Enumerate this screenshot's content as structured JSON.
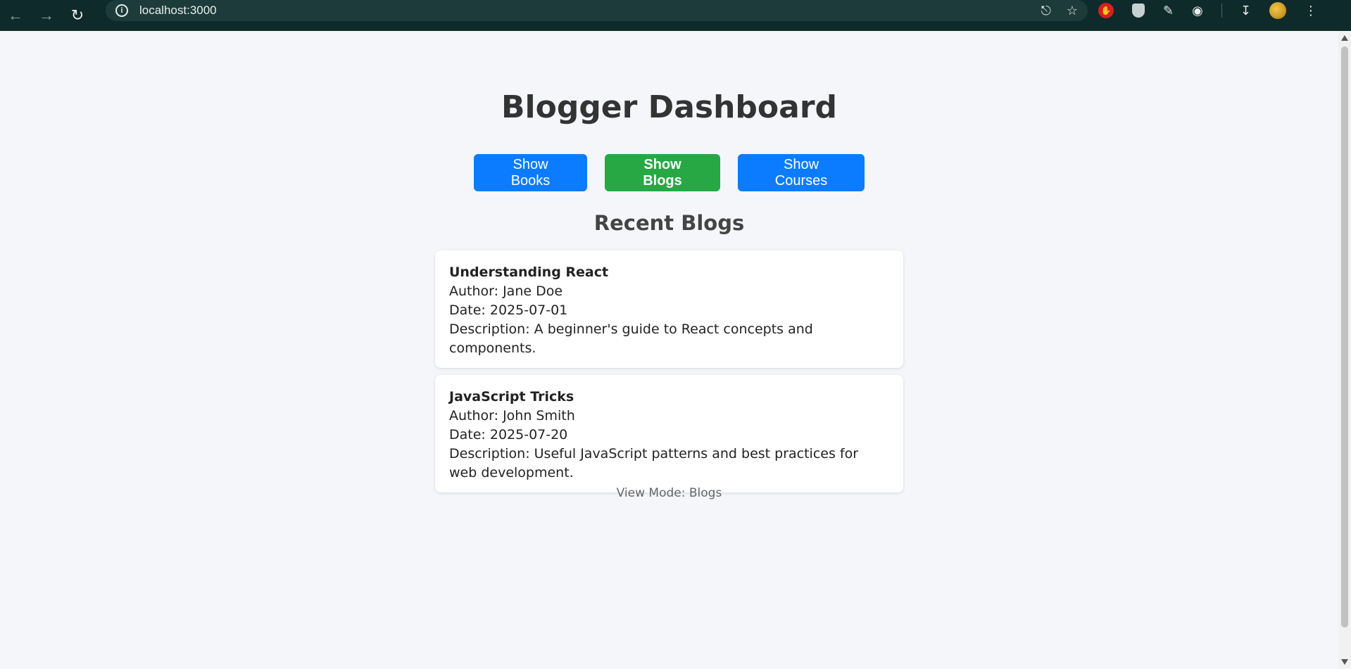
{
  "browser": {
    "url": "localhost:3000"
  },
  "page": {
    "title": "Blogger Dashboard",
    "buttons": {
      "books": "Show Books",
      "blogs": "Show Blogs",
      "courses": "Show Courses"
    },
    "section_title": "Recent Blogs",
    "blogs": [
      {
        "title": "Understanding React",
        "author": "Author: Jane Doe",
        "date": "Date: 2025-07-01",
        "description": "Description: A beginner's guide to React concepts and components."
      },
      {
        "title": "JavaScript Tricks",
        "author": "Author: John Smith",
        "date": "Date: 2025-07-20",
        "description": "Description: Useful JavaScript patterns and best practices for web development."
      }
    ],
    "view_mode": "View Mode: Blogs"
  },
  "colors": {
    "primary_blue": "#0b7cff",
    "active_green": "#28a745",
    "background": "#f4f6f9"
  }
}
